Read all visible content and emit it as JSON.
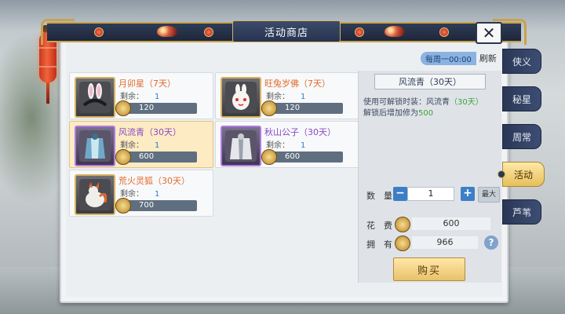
{
  "window": {
    "title": "活动商店",
    "close_label": "✕"
  },
  "refresh": {
    "time": "每周一00:00",
    "action": "刷新"
  },
  "items": [
    {
      "name": "月卯星（7天）",
      "remain_label": "剩余：",
      "remain": "1",
      "price": "120",
      "rarity": "orange",
      "icon": "rabbit-ear-headband-icon"
    },
    {
      "name": "旺兔岁佛（7天）",
      "remain_label": "剩余：",
      "remain": "1",
      "price": "120",
      "rarity": "orange",
      "icon": "rabbit-mask-icon"
    },
    {
      "name": "风流青（30天）",
      "remain_label": "剩余：",
      "remain": "1",
      "price": "600",
      "rarity": "purple",
      "icon": "blue-armor-outfit-icon"
    },
    {
      "name": "秋山公子（30天）",
      "remain_label": "剩余：",
      "remain": "1",
      "price": "600",
      "rarity": "purple",
      "icon": "white-robe-outfit-icon"
    },
    {
      "name": "荒火灵狐（30天）",
      "remain_label": "剩余：",
      "remain": "1",
      "price": "700",
      "rarity": "orange",
      "icon": "fire-fox-pet-icon"
    }
  ],
  "detail": {
    "title": "风流青（30天）",
    "desc_line1_prefix": "使用可解锁时装：风流青",
    "desc_line1_highlight": "（30天）",
    "desc_line2_prefix": "解锁后增加修为",
    "desc_line2_value": "500",
    "quantity_label": "数　量",
    "quantity": "1",
    "max_label": "最大",
    "cost_label": "花　费",
    "cost": "600",
    "own_label": "拥　有",
    "own": "966",
    "buy_label": "购买"
  },
  "tabs": [
    {
      "label": "侠义",
      "active": false
    },
    {
      "label": "秘星",
      "active": false
    },
    {
      "label": "周常",
      "active": false
    },
    {
      "label": "活动",
      "active": true
    },
    {
      "label": "芦苇",
      "active": false
    }
  ],
  "colors": {
    "orange_name": "#e26a2c",
    "purple_name": "#8a49c7",
    "accent_blue": "#3c7fc7",
    "gold": "#c9a24c"
  }
}
